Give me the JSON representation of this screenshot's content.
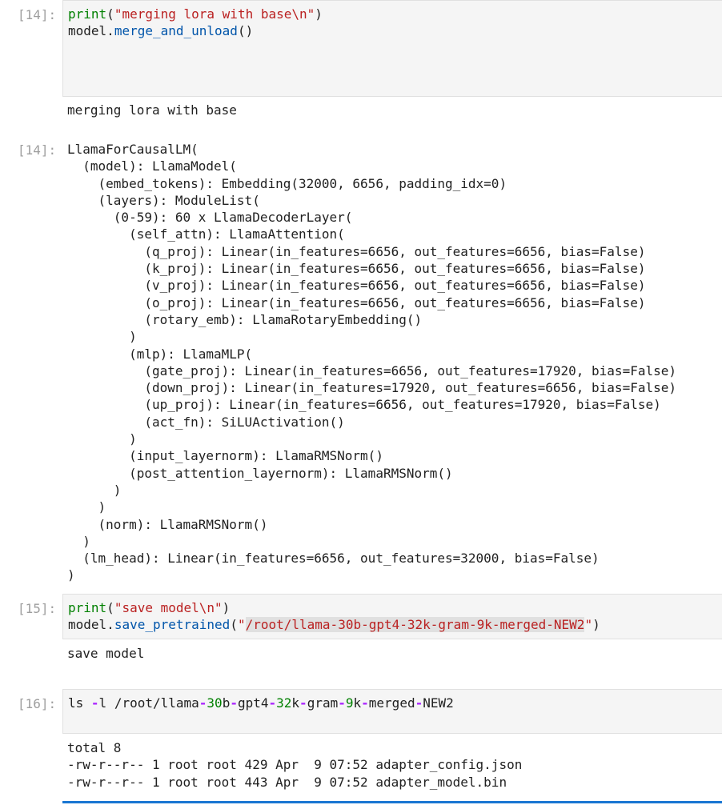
{
  "cells": [
    {
      "prompt": "[14]:",
      "input": {
        "line1": {
          "fn": "print",
          "p1": "(",
          "str": "\"merging lora with base\\n\"",
          "p2": ")"
        },
        "line2": {
          "obj": "model",
          "dot": ".",
          "fn": "merge_and_unload",
          "p": "()"
        }
      },
      "stdout": "merging lora with base"
    },
    {
      "prompt": "[14]:",
      "result": [
        "LlamaForCausalLM(",
        "  (model): LlamaModel(",
        "    (embed_tokens): Embedding(32000, 6656, padding_idx=0)",
        "    (layers): ModuleList(",
        "      (0-59): 60 x LlamaDecoderLayer(",
        "        (self_attn): LlamaAttention(",
        "          (q_proj): Linear(in_features=6656, out_features=6656, bias=False)",
        "          (k_proj): Linear(in_features=6656, out_features=6656, bias=False)",
        "          (v_proj): Linear(in_features=6656, out_features=6656, bias=False)",
        "          (o_proj): Linear(in_features=6656, out_features=6656, bias=False)",
        "          (rotary_emb): LlamaRotaryEmbedding()",
        "        )",
        "        (mlp): LlamaMLP(",
        "          (gate_proj): Linear(in_features=6656, out_features=17920, bias=False)",
        "          (down_proj): Linear(in_features=17920, out_features=6656, bias=False)",
        "          (up_proj): Linear(in_features=6656, out_features=17920, bias=False)",
        "          (act_fn): SiLUActivation()",
        "        )",
        "        (input_layernorm): LlamaRMSNorm()",
        "        (post_attention_layernorm): LlamaRMSNorm()",
        "      )",
        "    )",
        "    (norm): LlamaRMSNorm()",
        "  )",
        "  (lm_head): Linear(in_features=6656, out_features=32000, bias=False)",
        ")"
      ]
    },
    {
      "prompt": "[15]:",
      "input": {
        "line1": {
          "fn": "print",
          "p1": "(",
          "str": "\"save model\\n\"",
          "p2": ")"
        },
        "line2": {
          "obj": "model",
          "dot": ".",
          "fn": "save_pretrained",
          "p1": "(",
          "q1": "\"",
          "path": "/root/llama-30b-gpt4-32k-gram-9k-merged-NEW2",
          "q2": "\"",
          "p2": ")"
        }
      },
      "stdout": "save model"
    },
    {
      "prompt": "[16]:",
      "input": {
        "t1": "ls ",
        "op1": "-",
        "t2": "l /root/llama",
        "op2": "-",
        "n1": "30",
        "t3": "b",
        "op3": "-",
        "t4": "gpt4",
        "op4": "-",
        "n2": "32",
        "t5": "k",
        "op5": "-",
        "t6": "gram",
        "op6": "-",
        "n3": "9",
        "t7": "k",
        "op7": "-",
        "t8": "merged",
        "op8": "-",
        "t9": "NEW2"
      },
      "stdout": [
        "total 8",
        "-rw-r--r-- 1 root root 429 Apr  9 07:52 adapter_config.json",
        "-rw-r--r-- 1 root root 443 Apr  9 07:52 adapter_model.bin"
      ]
    }
  ]
}
